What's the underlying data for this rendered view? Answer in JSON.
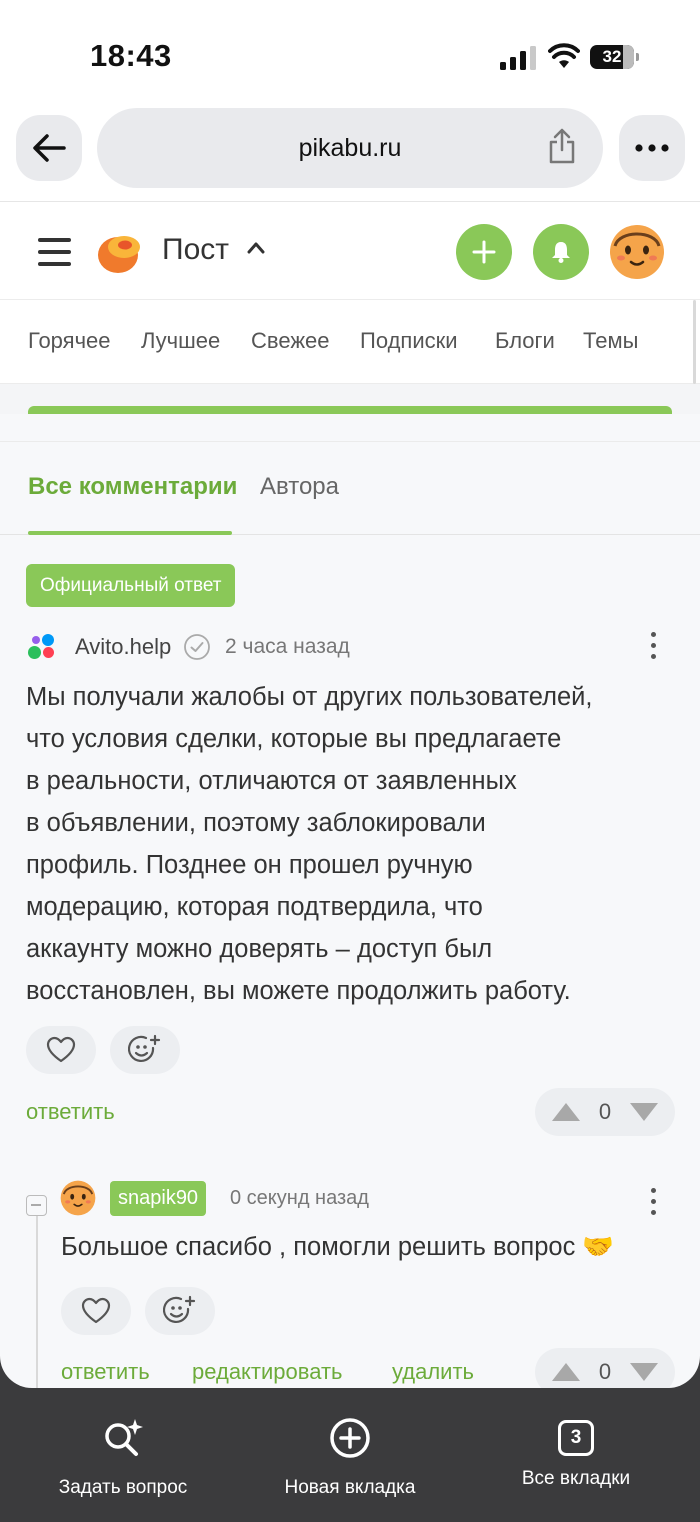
{
  "status_bar": {
    "time": "18:43",
    "battery": "32"
  },
  "browser": {
    "url": "pikabu.ru"
  },
  "header": {
    "title": "Пост"
  },
  "nav": [
    "Горячее",
    "Лучшее",
    "Свежее",
    "Подписки",
    "Блоги",
    "Темы"
  ],
  "comments": {
    "tabs": [
      "Все комментарии",
      "Автора"
    ],
    "official_badge": "Официальный ответ",
    "main": {
      "author": "Avito.help",
      "time": "2 часа назад",
      "text_lines": [
        "Мы получали жалобы от других пользователей,",
        "что условия сделки, которые вы предлагаете",
        "в реальности, отличаются от заявленных",
        "в объявлении, поэтому заблокировали",
        "профиль. Позднее он прошел ручную",
        "модерацию, которая подтвердила, что",
        "аккаунту можно доверять – доступ был",
        "восстановлен, вы можете продолжить работу."
      ],
      "reply_label": "ответить",
      "score": "0"
    },
    "reply": {
      "author": "snapik90",
      "time": "0 секунд назад",
      "text": "Большое спасибо , помогли решить вопрос 🤝",
      "actions": [
        "ответить",
        "редактировать",
        "удалить"
      ],
      "score": "0"
    }
  },
  "toolbar": {
    "ask": "Задать вопрос",
    "new_tab": "Новая вкладка",
    "all_tabs": "Все вкладки",
    "tab_count": "3"
  },
  "colors": {
    "accent": "#8ac858",
    "link": "#6cab3a",
    "toolbar": "#3b3b3d"
  }
}
